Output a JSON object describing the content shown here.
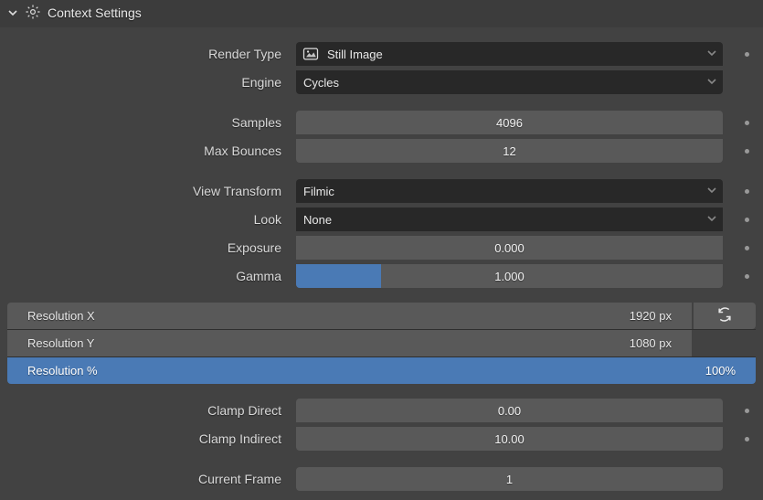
{
  "header": {
    "title": "Context Settings"
  },
  "render": {
    "type_label": "Render Type",
    "type_value": "Still Image",
    "engine_label": "Engine",
    "engine_value": "Cycles"
  },
  "sampling": {
    "samples_label": "Samples",
    "samples_value": "4096",
    "bounces_label": "Max Bounces",
    "bounces_value": "12"
  },
  "color": {
    "view_transform_label": "View Transform",
    "view_transform_value": "Filmic",
    "look_label": "Look",
    "look_value": "None",
    "exposure_label": "Exposure",
    "exposure_value": "0.000",
    "gamma_label": "Gamma",
    "gamma_value": "1.000"
  },
  "resolution": {
    "x_label": "Resolution X",
    "x_value": "1920 px",
    "y_label": "Resolution Y",
    "y_value": "1080 px",
    "pct_label": "Resolution %",
    "pct_value": "100%"
  },
  "clamp": {
    "direct_label": "Clamp Direct",
    "direct_value": "0.00",
    "indirect_label": "Clamp Indirect",
    "indirect_value": "10.00"
  },
  "frame": {
    "label": "Current Frame",
    "value": "1"
  }
}
